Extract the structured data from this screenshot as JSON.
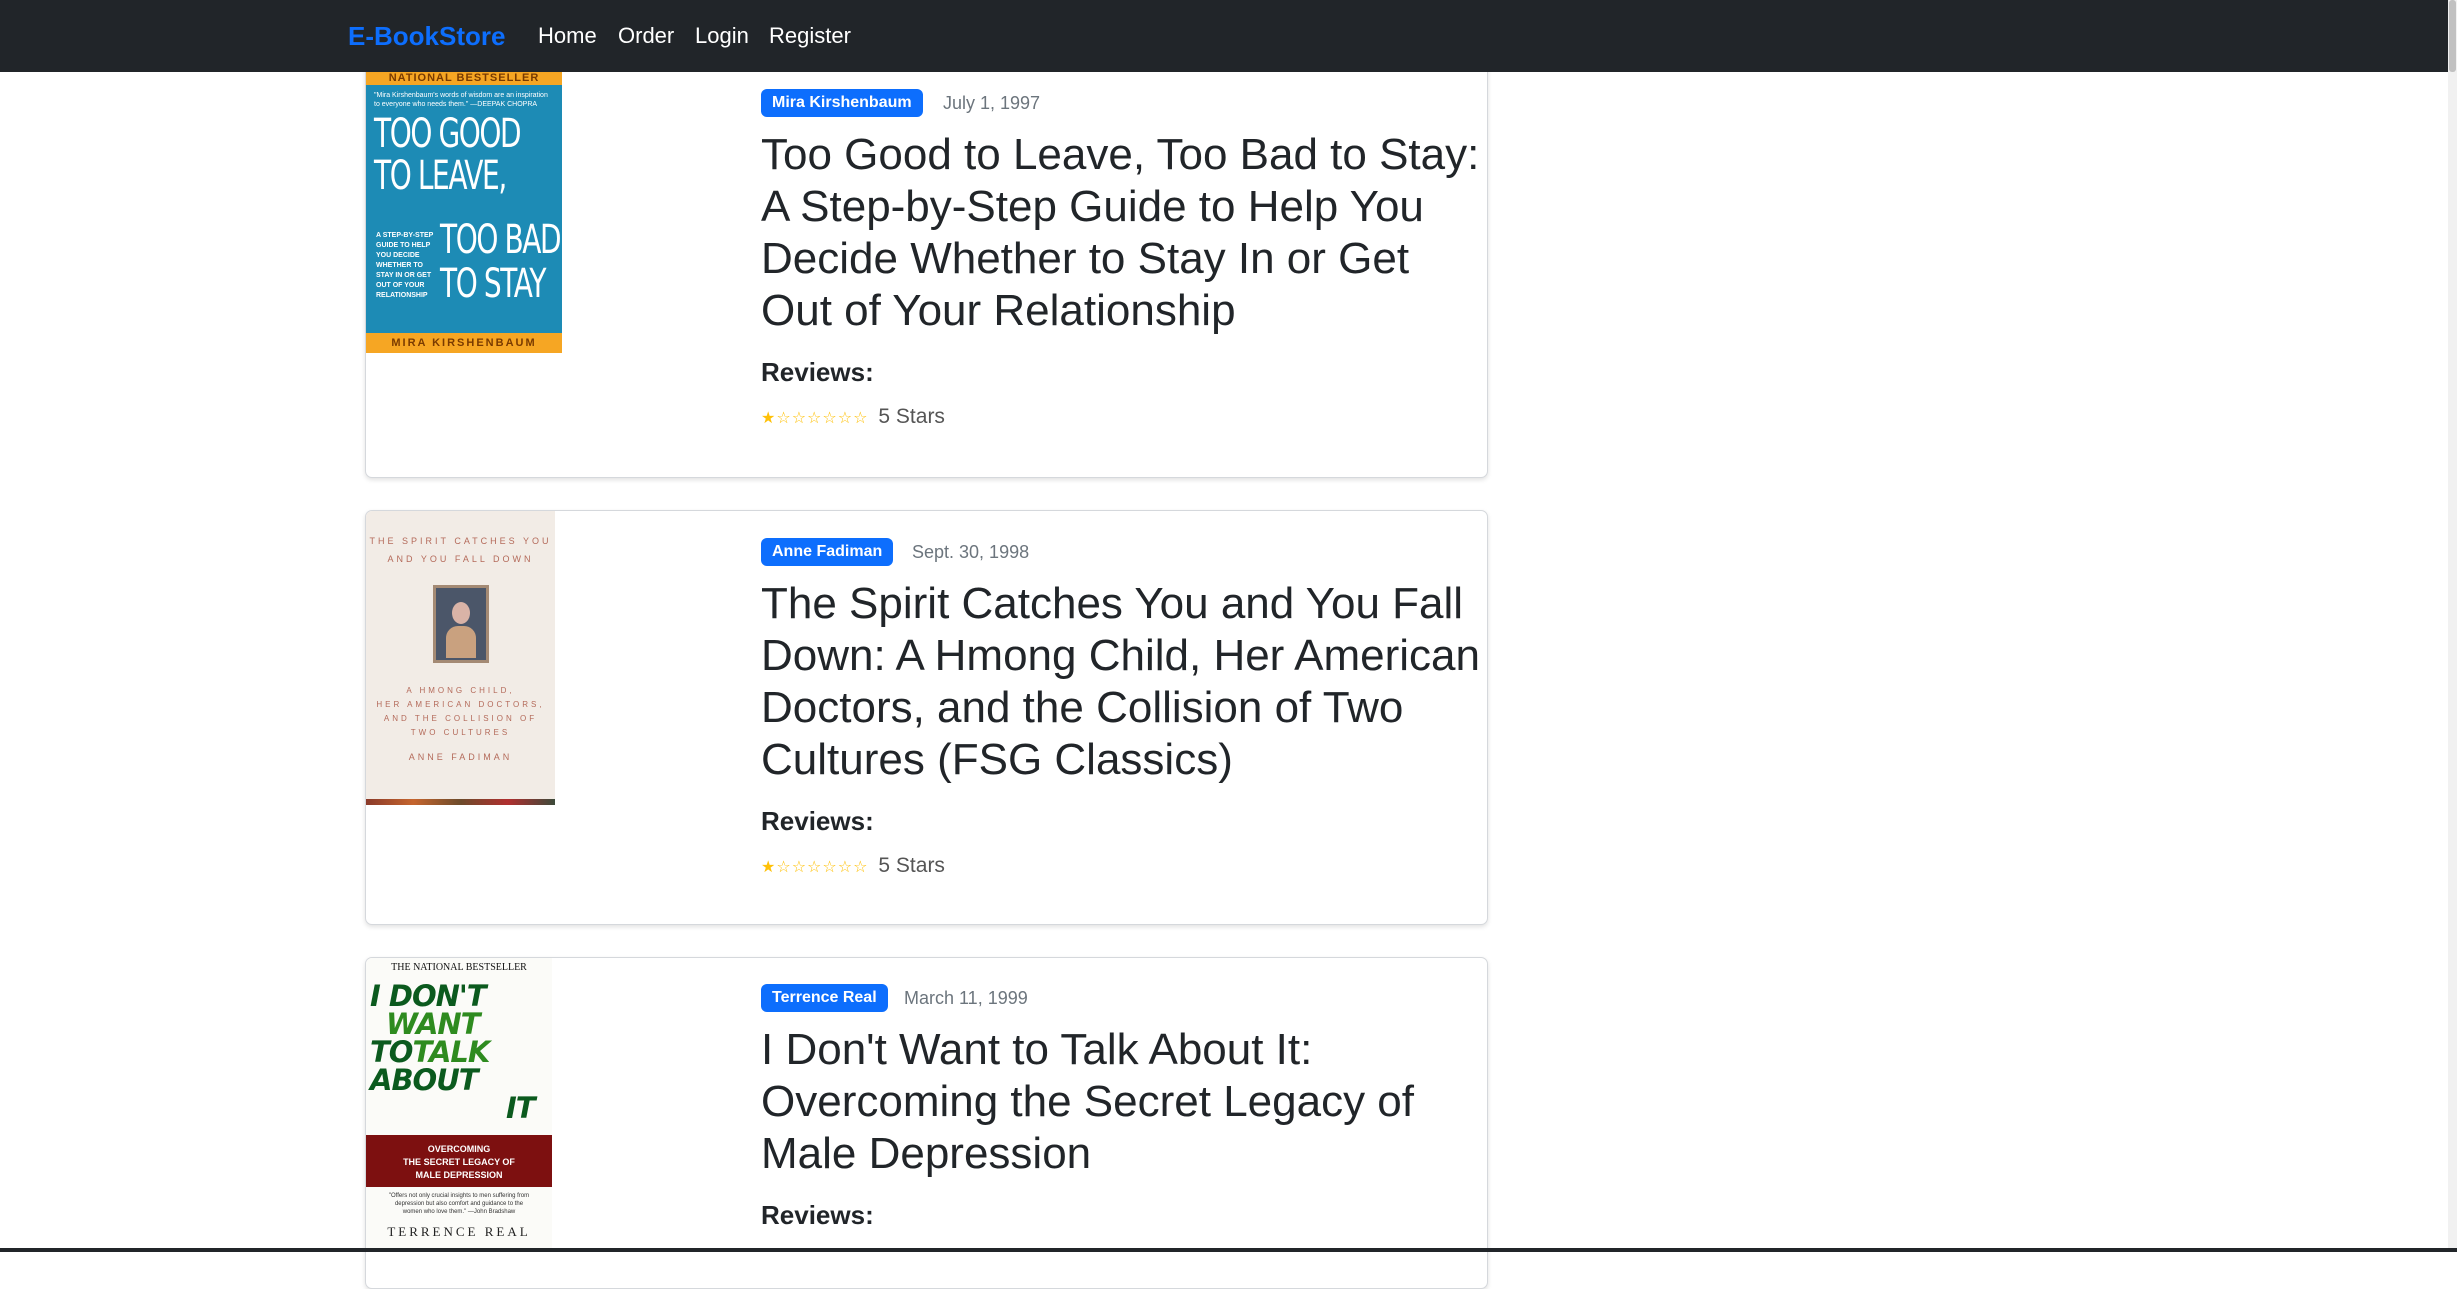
{
  "navbar": {
    "brand": "E-BookStore",
    "links": [
      "Home",
      "Order",
      "Login",
      "Register"
    ]
  },
  "books": [
    {
      "author": "Mira Kirshenbaum",
      "date": "July 1, 1997",
      "title": "Too Good to Leave, Too Bad to Stay: A Step-by-Step Guide to Help You Decide Whether to Stay In or Get Out of Your Relationship",
      "reviews_label": "Reviews:",
      "stars": "★☆☆☆☆☆☆",
      "rating_text": "5 Stars",
      "cover": {
        "top_band": "NATIONAL BESTSELLER",
        "quote": "\"Mira Kirshenbaum's words of wisdom are an inspiration to everyone who needs them.\" —DEEPAK CHOPRA",
        "line1": "TOO GOOD",
        "line2": "TO LEAVE,",
        "line3": "TOO BAD",
        "line4": "TO STAY",
        "subtitle": "A STEP-BY-STEP GUIDE TO HELP YOU DECIDE WHETHER TO STAY IN OR GET OUT OF YOUR RELATIONSHIP",
        "author_band": "MIRA KIRSHENBAUM"
      }
    },
    {
      "author": "Anne Fadiman",
      "date": "Sept. 30, 1998",
      "title": "The Spirit Catches You and You Fall Down: A Hmong Child, Her American Doctors, and the Collision of Two Cultures (FSG Classics)",
      "reviews_label": "Reviews:",
      "stars": "★☆☆☆☆☆☆",
      "rating_text": "5 Stars",
      "cover": {
        "line1": "THE SPIRIT CATCHES YOU",
        "line2": "AND YOU FALL DOWN",
        "sub1": "A HMONG CHILD,",
        "sub2": "HER AMERICAN DOCTORS,",
        "sub3": "AND THE COLLISION OF",
        "sub4": "TWO CULTURES",
        "author": "ANNE FADIMAN"
      }
    },
    {
      "author": "Terrence Real",
      "date": "March 11, 1999",
      "title": "I Don't Want to Talk About It: Overcoming the Secret Legacy of Male Depression",
      "reviews_label": "Reviews:",
      "cover": {
        "top": "THE NATIONAL BESTSELLER",
        "w1": "I DON'T",
        "w2": "WANT",
        "w3a": "TO",
        "w3b": "TALK",
        "w4": "ABOUT",
        "w5": "IT",
        "band1": "OVERCOMING",
        "band2": "THE SECRET LEGACY OF",
        "band3": "MALE DEPRESSION",
        "quote": "\"Offers not only crucial insights to men suffering from depression but also comfort and guidance to the women who love them.\" —John Bradshaw",
        "author": "TERRENCE REAL"
      }
    }
  ],
  "colors": {
    "navbar_bg": "#212529",
    "brand": "#0d6efd",
    "badge": "#0d6efd",
    "star": "#ffc107"
  }
}
